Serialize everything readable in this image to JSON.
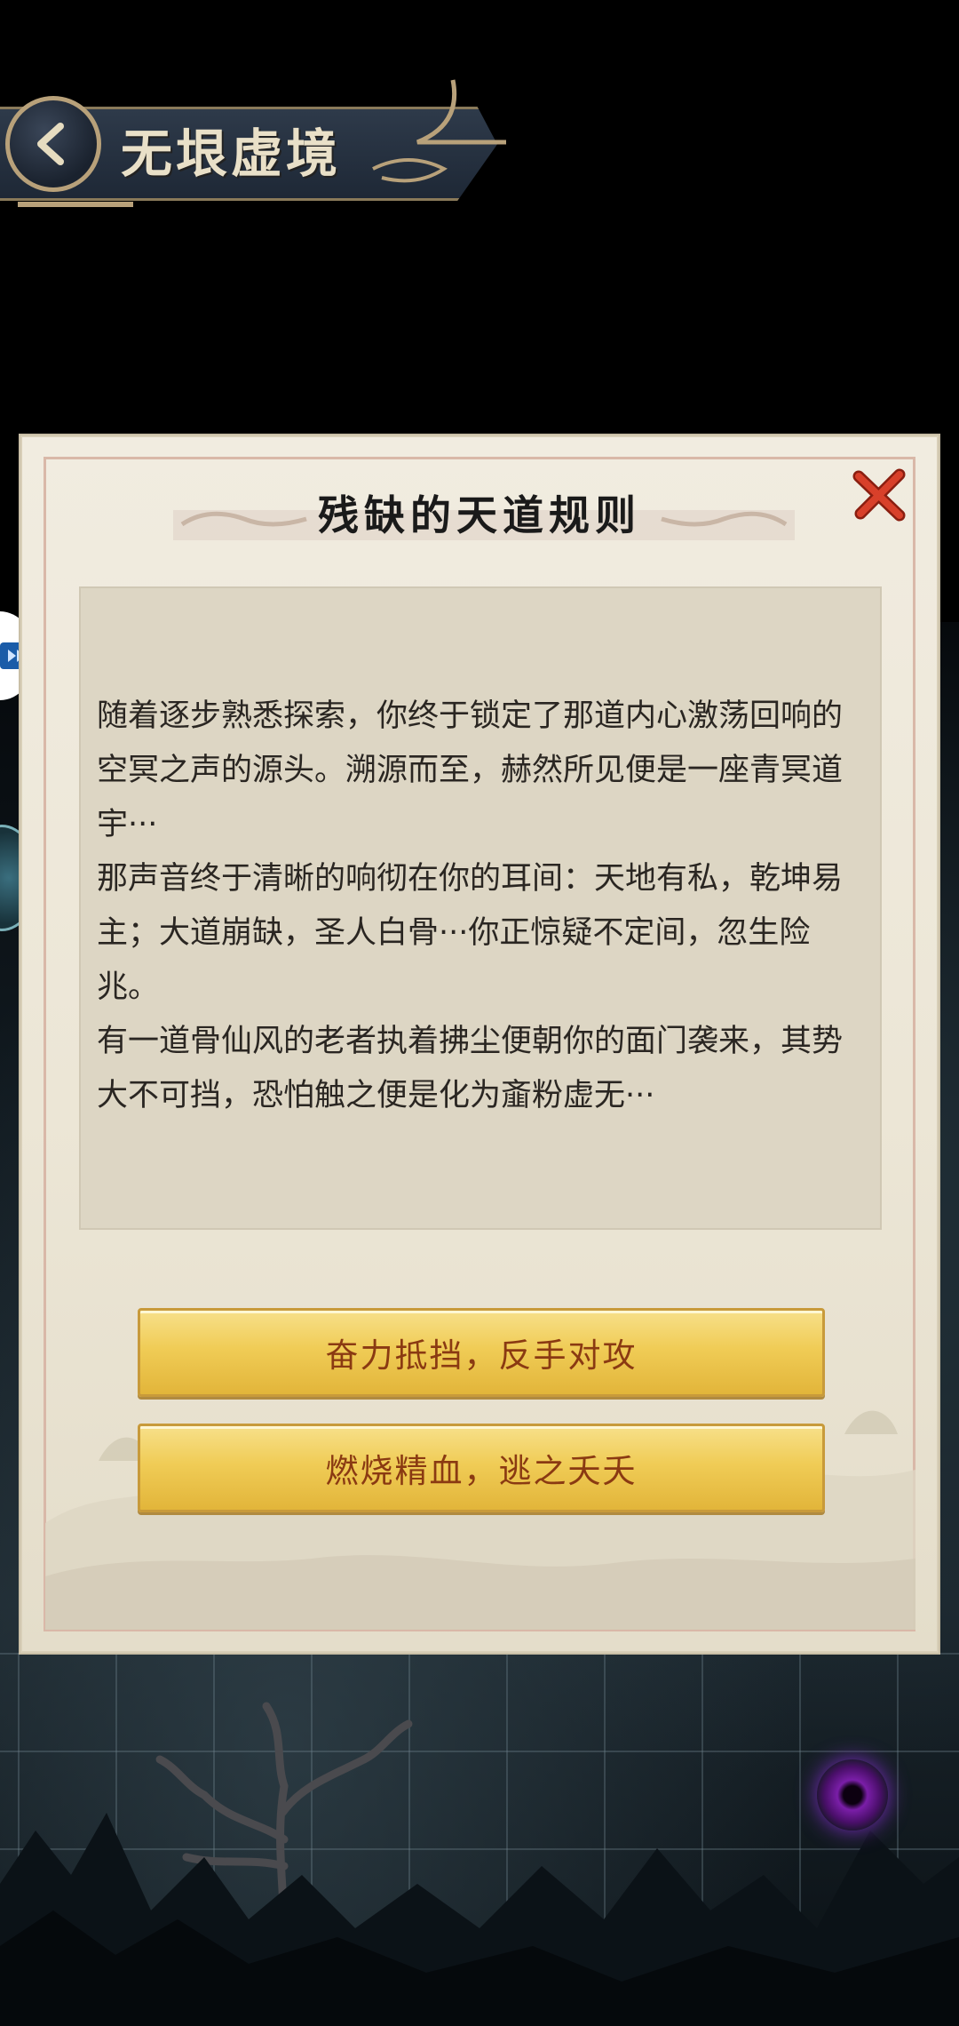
{
  "header": {
    "title": "无垠虚境",
    "back_icon": "chevron-left-icon"
  },
  "modal": {
    "title": "残缺的天道规则",
    "close_icon": "close-icon",
    "paragraphs": [
      "随着逐步熟悉探索，你终于锁定了那道内心激荡回响的空冥之声的源头。溯源而至，赫然所见便是一座青冥道宇···",
      "那声音终于清晰的响彻在你的耳间：天地有私，乾坤易主；大道崩缺，圣人白骨···你正惊疑不定间，忽生险兆。",
      "有一道骨仙风的老者执着拂尘便朝你的面门袭来，其势大不可挡，恐怕触之便是化为齑粉虚无···"
    ],
    "choices": [
      "奋力抵挡，反手对攻",
      "燃烧精血，逃之夭夭"
    ]
  },
  "colors": {
    "choice_text": "#8a3a12",
    "close_x": "#d8402a",
    "modal_bg": "#ece6d6",
    "text_panel_bg": "#ddd6c4"
  }
}
